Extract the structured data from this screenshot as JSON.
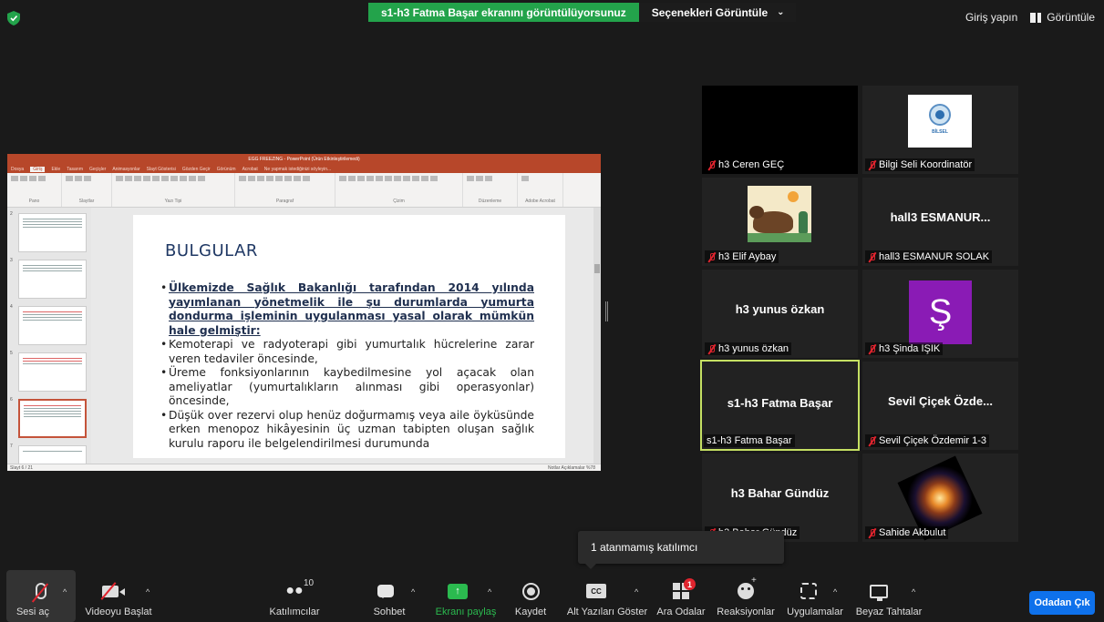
{
  "top_bar": {
    "sharing_banner": "s1-h3 Fatma Başar ekranını görüntülüyorsunuz",
    "view_options": "Seçenekleri Görüntüle",
    "sign_in": "Giriş yapın",
    "view": "Görüntüle"
  },
  "shared_screen": {
    "window_title": "EGG FREEZING - PowerPoint (Ürün Etkinleştirilemedi)",
    "ribbon_tabs": [
      "Dosya",
      "Giriş",
      "Ekle",
      "Tasarım",
      "Geçişler",
      "Animasyonlar",
      "Slayt Gösterisi",
      "Gözden Geçir",
      "Görünüm",
      "Acrobat",
      "Ne yapmak istediğinizi söyleyin..."
    ],
    "ribbon_groups": [
      "Pano",
      "Slaytlar",
      "Yazı Tipi",
      "Paragraf",
      "Çizim",
      "Düzenleme",
      "Adobe Acrobat"
    ],
    "thumbnail_numbers": [
      "2",
      "3",
      "4",
      "5",
      "6",
      "7"
    ],
    "status_left": "Slayt 6 / 21",
    "status_right": "Notlar   Açıklamalar   %78",
    "slide": {
      "title": "BULGULAR",
      "bullets": [
        {
          "text": "Ülkemizde Sağlık Bakanlığı tarafından 2014 yılında yayımlanan yönetmelik ile şu durumlarda yumurta dondurma işleminin uygulanması yasal olarak mümkün hale gelmiştir:",
          "bold": true
        },
        {
          "text": "Kemoterapi ve radyoterapi gibi yumurtalık hücrelerine zarar veren tedaviler öncesinde,",
          "bold": false
        },
        {
          "text": "Üreme fonksiyonlarının kaybedilmesine yol açacak olan ameliyatlar (yumurtalıkların alınması gibi operasyonlar) öncesinde,",
          "bold": false
        },
        {
          "text": "Düşük over rezervi olup henüz doğurmamış veya aile öyküsünde erken menopoz hikâyesinin üç uzman tabipten oluşan sağlık kurulu raporu ile belgelendirilmesi durumunda",
          "bold": false
        }
      ]
    }
  },
  "participants": [
    {
      "center": "",
      "name": "h3 Ceren GEÇ",
      "muted": true
    },
    {
      "center": "",
      "name": "Bilgi Seli Koordinatör",
      "muted": true,
      "logo_text": "BİLSEL"
    },
    {
      "center": "",
      "name": "h3 Elif Aybay",
      "muted": true
    },
    {
      "center": "hall3  ESMANUR...",
      "name": "hall3 ESMANUR SOLAK",
      "muted": true
    },
    {
      "center": "h3 yunus özkan",
      "name": "h3 yunus özkan",
      "muted": true
    },
    {
      "center": "",
      "name": "h3 Şinda IŞIK",
      "muted": true,
      "avatar_letter": "Ş"
    },
    {
      "center": "s1-h3 Fatma Başar",
      "name": "s1-h3 Fatma Başar",
      "muted": false
    },
    {
      "center": "Sevil Çiçek Özde...",
      "name": "Sevil Çiçek Özdemir 1-3",
      "muted": true
    },
    {
      "center": "h3 Bahar Gündüz",
      "name": "h3 Bahar Gündüz",
      "muted": true
    },
    {
      "center": "",
      "name": "Sahide Akbulut",
      "muted": true
    }
  ],
  "tooltip": "1 atanmamış katılımcı",
  "toolbar": {
    "unmute": "Sesi aç",
    "start_video": "Videoyu Başlat",
    "participants": "Katılımcılar",
    "participants_count": "10",
    "chat": "Sohbet",
    "share_screen": "Ekranı paylaş",
    "record": "Kaydet",
    "captions": "Alt Yazıları Göster",
    "captions_icon": "CC",
    "breakout_rooms": "Ara Odalar",
    "breakout_badge": "1",
    "reactions": "Reaksiyonlar",
    "apps": "Uygulamalar",
    "whiteboards": "Beyaz Tahtalar",
    "leave": "Odadan Çık"
  },
  "colors": {
    "banner_green": "#23a34b",
    "leave_blue": "#0e71eb",
    "speaker_border": "#c5e063",
    "mute_red": "#e0242e",
    "ppt_red": "#b7472a"
  }
}
